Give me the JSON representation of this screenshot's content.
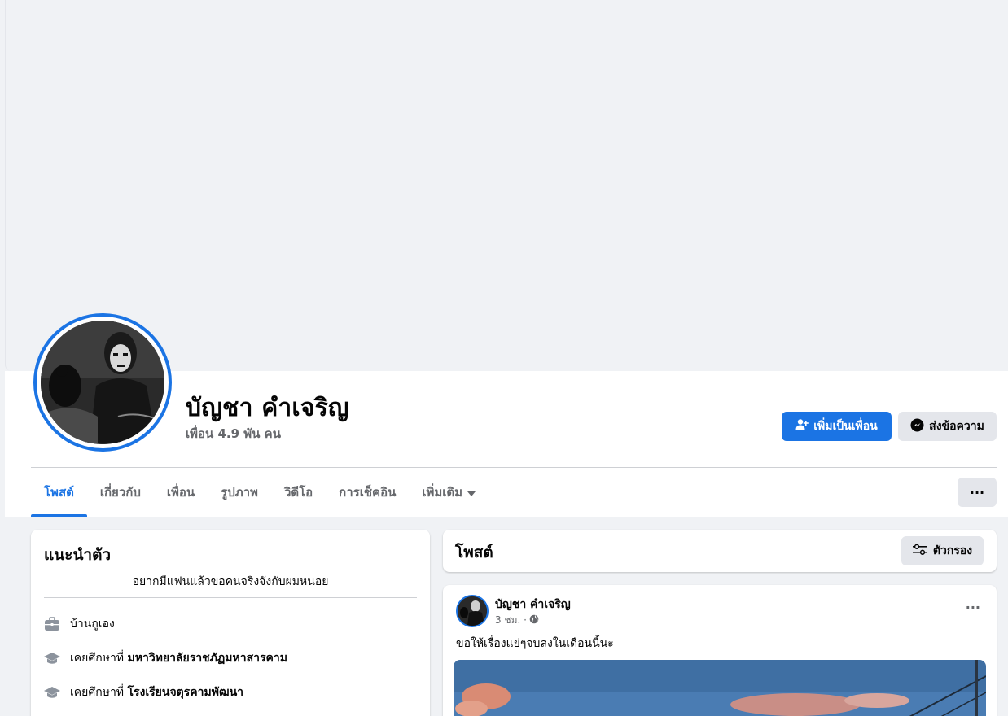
{
  "profile": {
    "name": "บัญชา คำเจริญ",
    "friends_count": "เพื่อน 4.9 พัน คน"
  },
  "actions": {
    "add_friend_label": "เพิ่มเป็นเพื่อน",
    "message_label": "ส่งข้อความ"
  },
  "tabs": [
    {
      "label": "โพสต์",
      "active": true
    },
    {
      "label": "เกี่ยวกับ"
    },
    {
      "label": "เพื่อน"
    },
    {
      "label": "รูปภาพ"
    },
    {
      "label": "วิดีโอ"
    },
    {
      "label": "การเช็คอิน"
    },
    {
      "label": "เพิ่มเติม"
    }
  ],
  "tab_more_label": "···",
  "intro": {
    "title": "แนะนำตัว",
    "bio": "อยากมีแฟนแล้วขอคนจริงจังกับผมหน่อย",
    "items": [
      {
        "icon": "briefcase-icon",
        "text": "บ้านกูเอง"
      },
      {
        "icon": "graduation-cap-icon",
        "prefix": "เคยศึกษาที่",
        "bold": "มหาวิทยาลัยราชภัฏมหาสารคาม"
      },
      {
        "icon": "graduation-cap-icon",
        "prefix": "เคยศึกษาที่",
        "bold": "โรงเรียนจตุรคามพัฒนา"
      }
    ]
  },
  "posts_section": {
    "title": "โพสต์",
    "filter_label": "ตัวกรอง"
  },
  "post": {
    "author": "บัญชา คำเจริญ",
    "time": "3 ชม. ·",
    "privacy_icon": "globe-icon",
    "text": "ขอให้เรื่องแย่ๆจบลงในเดือนนี้นะ",
    "more_label": "···"
  },
  "colors": {
    "accent": "#1b74e4",
    "page_bg": "#f0f2f5",
    "secondary_btn": "#e4e6eb"
  }
}
